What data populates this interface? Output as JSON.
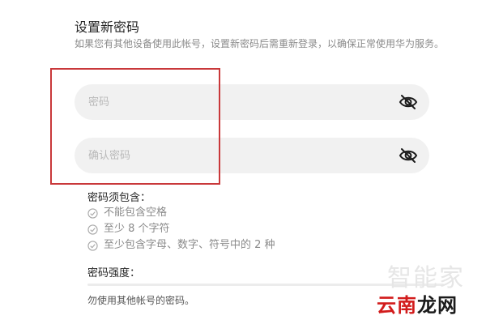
{
  "page": {
    "title": "设置新密码",
    "description": "如果您有其他设备使用此帐号，设置新密码后需重新登录，以确保正常使用华为服务。"
  },
  "form": {
    "password_placeholder": "密码",
    "confirm_placeholder": "确认密码",
    "password_value": "",
    "confirm_value": "",
    "eye_icon": "eye-slash-icon"
  },
  "requirements": {
    "title": "密码须包含：",
    "items": [
      "不能包含空格",
      "至少 8 个字符",
      "至少包含字母、数字、符号中的 2 种"
    ],
    "check_icon": "check-circle-icon"
  },
  "strength": {
    "title": "密码强度：",
    "level": 0,
    "hint": "勿使用其他帐号的密码。"
  },
  "watermark": {
    "faded_text": "智能家",
    "brand_part1": "云南",
    "brand_part2": "龙网"
  },
  "colors": {
    "annotation_box": "#c9383a",
    "field_bg": "#f1f1f1",
    "muted_text": "#8a8a8a",
    "watermark_red": "#d21c1c"
  }
}
